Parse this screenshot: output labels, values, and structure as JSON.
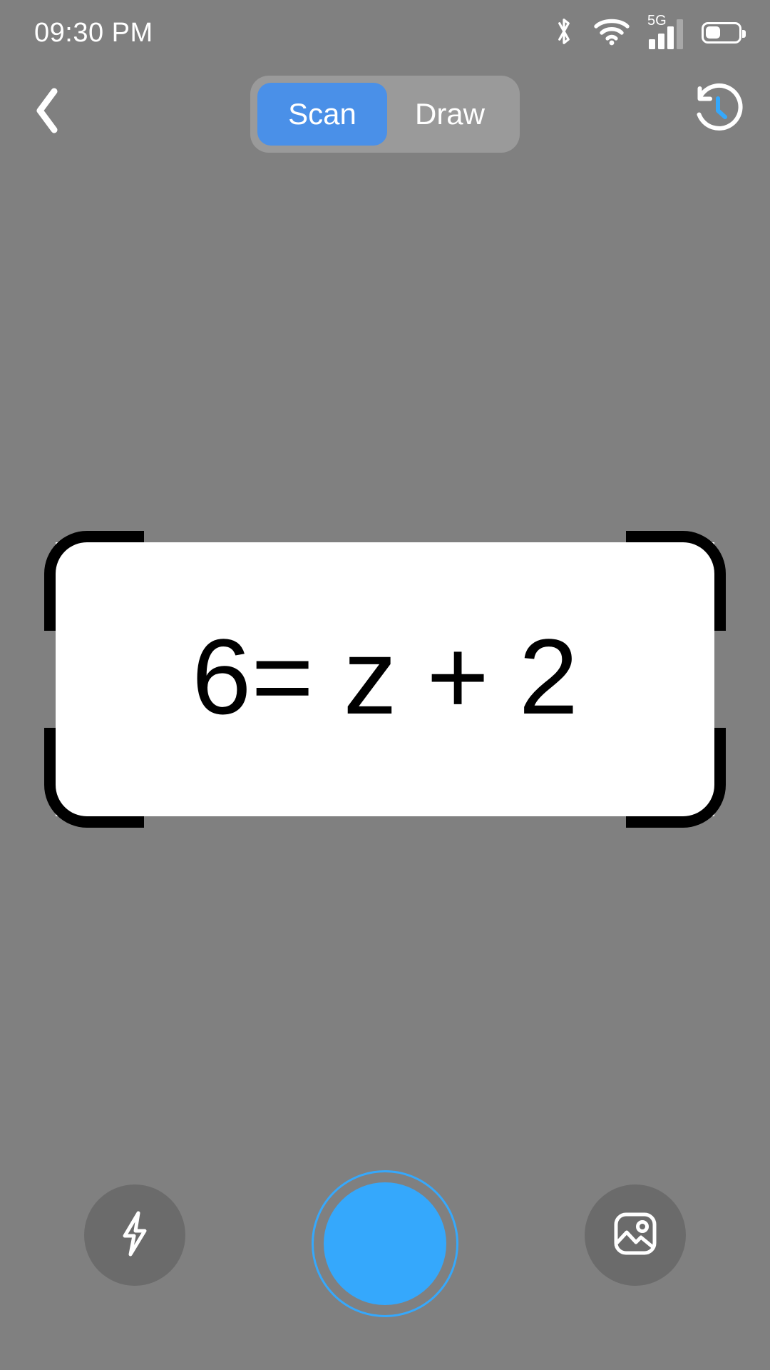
{
  "status_bar": {
    "time": "09:30 PM",
    "network_label": "5G",
    "icons": {
      "bluetooth": "bluetooth-icon",
      "wifi": "wifi-icon",
      "signal": "cellular-signal-icon",
      "battery": "battery-icon"
    },
    "signal_bars_total": 4,
    "signal_bars_filled": 3,
    "battery_percent": 40,
    "text_color": "#ffffff"
  },
  "top_bar": {
    "back_icon": "chevron-left-icon",
    "history_icon": "history-clock-icon",
    "modes": [
      {
        "label": "Scan",
        "active": true
      },
      {
        "label": "Draw",
        "active": false
      }
    ],
    "active_color": "#4a90e8",
    "track_color": "#9a9a9a"
  },
  "scan": {
    "equation": "6= z + 2",
    "card_color": "#ffffff",
    "bracket_color": "#000000",
    "text_color": "#000000"
  },
  "bottom_bar": {
    "flash_icon": "flash-bolt-icon",
    "gallery_icon": "image-gallery-icon",
    "shutter_icon": "camera-shutter-button",
    "shutter_color": "#35a8fc",
    "button_bg_color": "#6b6b6b"
  },
  "theme": {
    "background": "#808080",
    "accent": "#35a8fc"
  }
}
